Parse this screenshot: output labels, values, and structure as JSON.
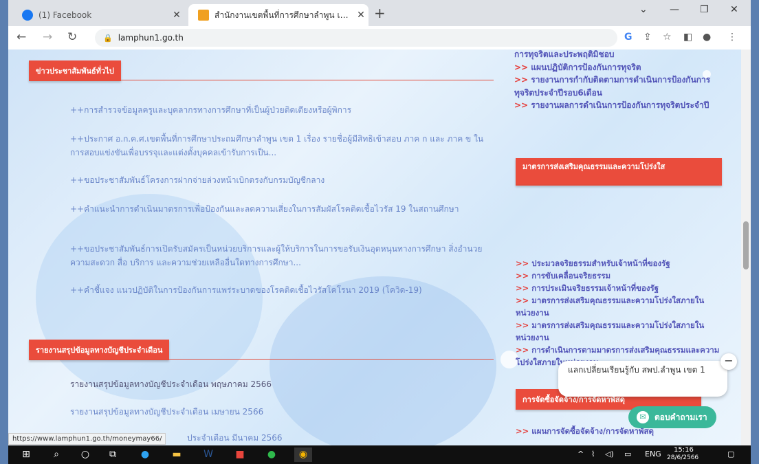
{
  "browser": {
    "tabs": [
      {
        "title": "(1) Facebook"
      },
      {
        "title": "สำนักงานเขตพื้นที่การศึกษาลำพูน เขต 1"
      }
    ],
    "address": "lamphun1.go.th",
    "status_url": "https://www.lamphun1.go.th/moneymay66/"
  },
  "left": {
    "news_heading": "ข่าวประชาสัมพันธ์ทั่วไป",
    "news": [
      "++การสำรวจข้อมูลครูและบุคลากรทางการศึกษาที่เป็นผู้ป่วยติดเตียงหรือผู้พิการ",
      "++ประกาศ อ.ก.ค.ศ.เขตพื้นที่การศึกษาประถมศึกษาลำพูน เขต 1 เรื่อง รายชื่อผู้มีสิทธิเข้าสอบ ภาค ก และ ภาค ข ในการสอบแข่งขันเพื่อบรรจุและแต่งตั้งบุคคลเข้ารับการเป็น...",
      "++ขอประชาสัมพันธ์โครงการฝากจ่ายล่วงหน้าเบิกตรงกับกรมบัญชีกลาง",
      "++คำแนะนำการดำเนินมาตรการเพื่อป้องกันและลดความเสี่ยงในการสัมผัสโรคติดเชื้อไวรัส 19 ในสถานศึกษา",
      "++ขอประชาสัมพันธ์การเปิดรับสมัครเป็นหน่วยบริการและผู้ให้บริการในการขอรับเงินอุดหนุนทางการศึกษา สิ่งอำนวยความสะดวก สื่อ บริการ และความช่วยเหลืออื่นใดทางการศึกษา...",
      "++คำชี้แจง แนวปฏิบัติในการป้องกันการแพร่ระบาดของโรคติดเชื้อไวรัสโคโรนา 2019 (โควิด-19)"
    ],
    "report_heading": "รายงานสรุปข้อมูลทางบัญชีประจำเดือน",
    "reports": [
      "รายงานสรุปข้อมูลทางบัญชีประจำเดือน พฤษภาคม 2566",
      "รายงานสรุปข้อมูลทางบัญชีประจำเดือน เมษายน 2566",
      "ประจำเดือน มีนาคม 2566"
    ]
  },
  "right": {
    "top_list": [
      {
        "arrow": "",
        "text": "การทุจริตและประพฤติมิชอบ"
      },
      {
        "arrow": ">>",
        "text": "แผนปฏิบัติการป้องกันการทุจริต"
      },
      {
        "arrow": ">>",
        "text": "รายงานการกำกับติดตามการดำเนินการป้องกันการทุจริตประจำปีรอบ6เดือน"
      },
      {
        "arrow": ">>",
        "text": "รายงานผลการดำเนินการป้องกันการทุจริตประจำปี"
      }
    ],
    "heading1": "มาตรการส่งเสริมคุณธรรมและความโปร่งใส",
    "list": [
      "ประมวลจริยธรรมสำหรับเจ้าหน้าที่ของรัฐ",
      "การขับเคลื่อนจริยธรรม",
      "การประเมินจริยธรรมเจ้าหน้าที่ของรัฐ",
      "มาตรการส่งเสริมคุณธรรมและความโปร่งใสภายในหน่วยงาน",
      "มาตรการส่งเสริมคุณธรรมและความโปร่งใสภายในหน่วยงาน",
      "การดำเนินการตามมาตรการส่งเสริมคุณธรรมและความโปร่งใสภายในหน่วยงาน"
    ],
    "heading2": "การจัดซื้อจัดจ้าง/การจัดหาพัสดุ",
    "bottom_item": "แผนการจัดซื้อจัดจ้าง/การจัดหาพัสดุ"
  },
  "chat": {
    "bubble_text": "แลกเปลี่ยนเรียนรู้กับ สพป.ลำพูน เขต 1",
    "button_label": "ตอบคำถามเรา",
    "close": "−"
  },
  "taskbar": {
    "lang": "ENG",
    "time": "15:16",
    "date": "28/6/2566"
  }
}
